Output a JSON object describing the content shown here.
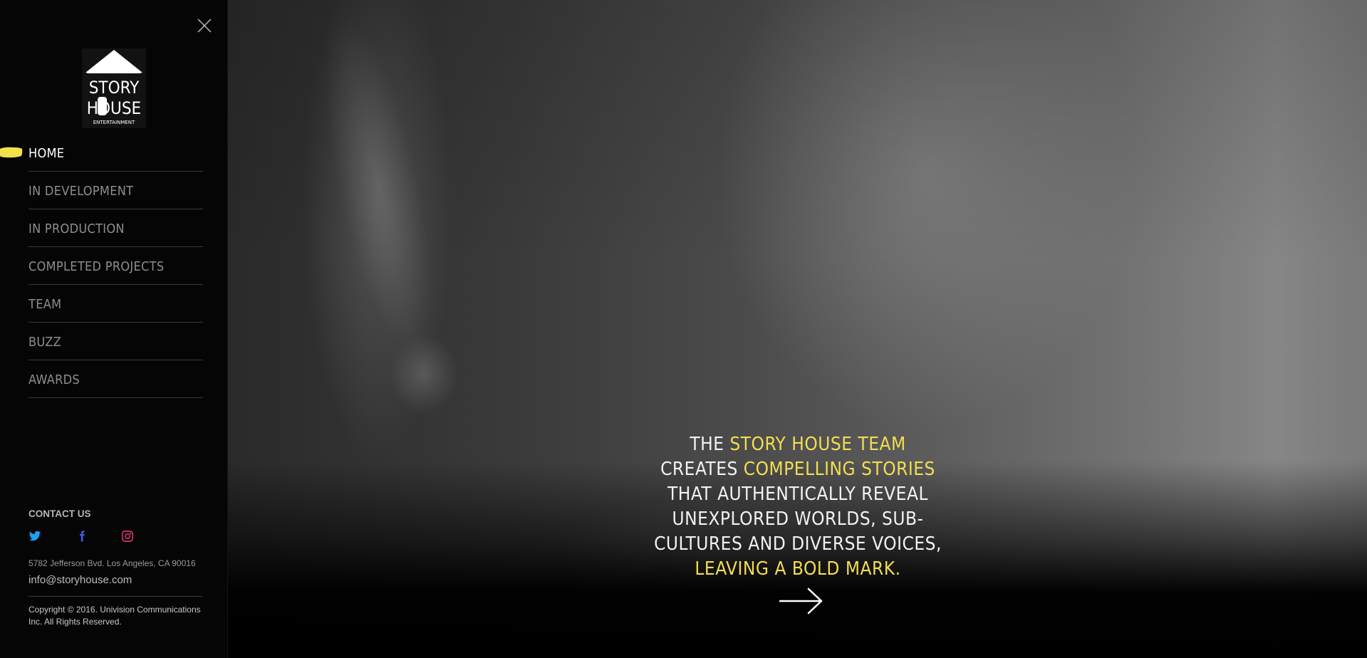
{
  "colors": {
    "accent_yellow": "#f2dd52",
    "sidebar_bg": "#050505",
    "nav_text": "#8e8e8e",
    "nav_active": "#ffffff",
    "twitter": "#1da1f2",
    "facebook": "#3b5ee8",
    "instagram": "#e1306c"
  },
  "logo": {
    "line1": "STORY",
    "line2": "HOUSE",
    "line3": "ENTERTAINMENT"
  },
  "nav": {
    "items": [
      {
        "label": "Home",
        "active": true
      },
      {
        "label": "In Development",
        "active": false
      },
      {
        "label": "In Production",
        "active": false
      },
      {
        "label": "Completed Projects",
        "active": false
      },
      {
        "label": "Team",
        "active": false
      },
      {
        "label": "Buzz",
        "active": false
      },
      {
        "label": "Awards",
        "active": false
      }
    ]
  },
  "contact": {
    "heading": "CONTACT US",
    "social": [
      {
        "icon": "twitter-icon"
      },
      {
        "icon": "facebook-icon"
      },
      {
        "icon": "instagram-icon"
      }
    ],
    "address": "5782 Jefferson Bvd. Los Angeles, CA 90016",
    "email": "info@storyhouse.com"
  },
  "footer": {
    "copyright": "Copyright © 2016. Univision Communications Inc. All Rights Reserved."
  },
  "hero": {
    "tagline": {
      "p1": "The ",
      "h1": "Story House Team",
      "p2": " creates ",
      "h2": "compelling stories",
      "p3": " that authentically reveal unexplored worlds, sub-cultures and diverse voices, ",
      "h3": "leaving a bold mark."
    },
    "arrow_icon": "arrow-right-icon"
  }
}
